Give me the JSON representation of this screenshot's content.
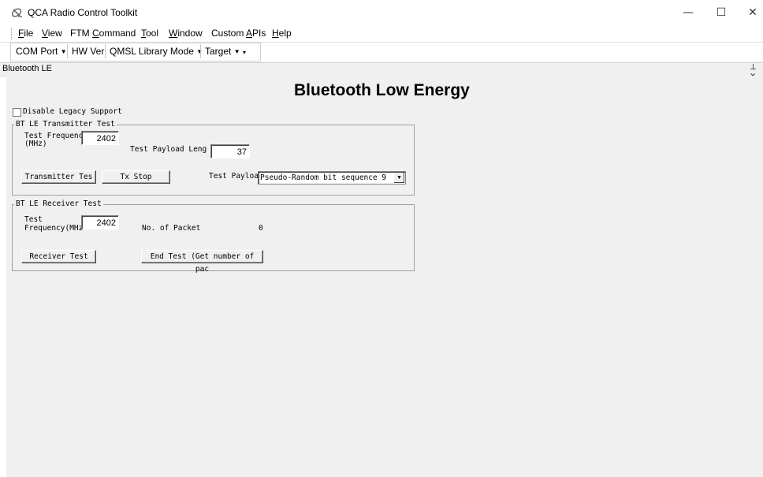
{
  "window": {
    "title": "QCA Radio Control Toolkit",
    "icon": "satellite-dish-icon",
    "controls": {
      "minimize": "—",
      "maximize": "☐",
      "close": "✕"
    }
  },
  "menu": {
    "items": [
      {
        "label": "File"
      },
      {
        "label": "View"
      },
      {
        "label": "FTM Command"
      },
      {
        "label": "Tool"
      },
      {
        "label": "Window"
      },
      {
        "label": "Custom APIs"
      },
      {
        "label": "Help"
      }
    ]
  },
  "toolbar": {
    "com_port": "COM Port",
    "hw_ver": "HW Ver",
    "qmsl_mode": "QMSL Library Mode",
    "target": "Target"
  },
  "panel": {
    "tab_title": "Bluetooth LE",
    "pin": "⊥ ×",
    "heading": "Bluetooth Low Energy",
    "disable_legacy": {
      "label": "Disable Legacy Support",
      "checked": false
    },
    "transmitter": {
      "legend": "BT LE Transmitter Test",
      "freq_label_1": "Test Frequency",
      "freq_label_2": "(MHz)",
      "freq_value": "2402",
      "payload_len_label": "Test Payload Leng",
      "payload_len_value": "37",
      "tx_button": "Transmitter Tes",
      "stop_button": "Tx Stop",
      "payload_label": "Test Payloa",
      "payload_value": "Pseudo-Random bit sequence 9"
    },
    "receiver": {
      "legend": "BT LE Receiver Test",
      "freq_label_1": "Test",
      "freq_label_2": "Frequency(MHz",
      "freq_value": "2402",
      "packets_label": "No. of Packet",
      "packets_value": "0",
      "rx_button": "Receiver Test",
      "end_button": "End Test (Get number of pac"
    }
  }
}
